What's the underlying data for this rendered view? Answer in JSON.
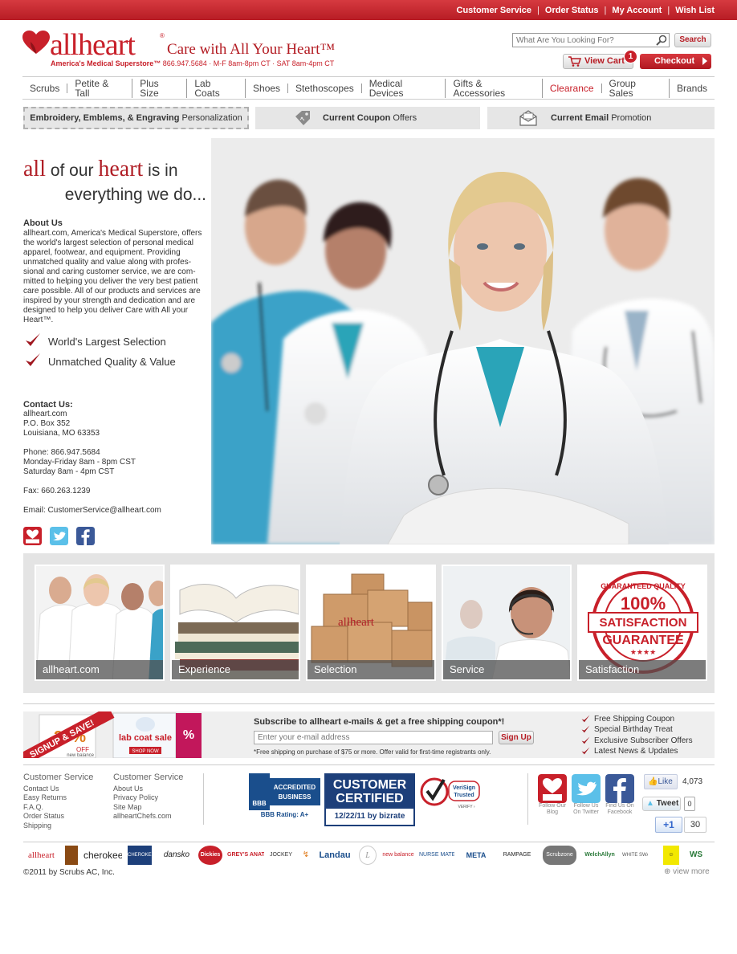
{
  "topbar": {
    "links": [
      "Customer Service",
      "Order Status",
      "My Account",
      "Wish List"
    ]
  },
  "header": {
    "logo_text": "allheart",
    "logo_tm": "®",
    "tagline": "Care with All Your Heart™",
    "subtag_name": "America's Medical Superstore™",
    "subtag_info": " 866.947.5684 · M-F 8am-8pm CT · SAT 8am-4pm CT",
    "search_placeholder": "What Are You Looking For?",
    "search_label": "Search",
    "cart_label": "View Cart",
    "cart_count": "1",
    "checkout_label": "Checkout"
  },
  "nav": [
    "Scrubs",
    "Petite & Tall",
    "Plus Size",
    "Lab Coats",
    "Shoes",
    "Stethoscopes",
    "Medical Devices",
    "Gifts & Accessories",
    "Clearance",
    "Group Sales",
    "Brands"
  ],
  "promo": {
    "p1_bold": "Embroidery, Emblems, & Engraving",
    "p1_rest": " Personalization",
    "p2_bold": "Current Coupon",
    "p2_rest": " Offers",
    "p3_bold": "Current Email",
    "p3_rest": " Promotion"
  },
  "intro": {
    "w1": "all",
    "w2": " of our ",
    "w3": "heart",
    "w4": " is in",
    "line2": "everything we do...",
    "about_title": "About Us",
    "about_text": "allheart.com, America's Medical Superstore, offers the world's largest selection of personal medical apparel, footwear, and equipment. Providing unmatched quality and value along with profes-sional and caring customer service, we are com-mitted to helping you deliver the very best patient care possible. All of our products and services are inspired by your strength and dedication and are designed to help you deliver Care with All your Heart™.",
    "check1": "World's Largest Selection",
    "check2": "Unmatched Quality & Value"
  },
  "contact": {
    "title": "Contact Us:",
    "l1": "allheart.com",
    "l2": "P.O. Box 352",
    "l3": "Louisiana, MO 63353",
    "phone": "Phone: 866.947.5684",
    "hours1": "Monday-Friday 8am - 8pm CST",
    "hours2": "Saturday 8am - 4pm CST",
    "fax": "Fax: 660.263.1239",
    "email": "Email: CustomerService@allheart.com"
  },
  "tiles": [
    "allheart.com",
    "Experience",
    "Selection",
    "Service",
    "Satisfaction"
  ],
  "tile_text": {
    "boxes": "allheart",
    "seal_1": "100%",
    "seal_2": "SATISFACTION",
    "seal_3": "GUARANTEE",
    "seal_stars": "★★★★",
    "seal_ring": "GUARANTEED QUALITY"
  },
  "signup": {
    "banner": "SIGNUP & SAVE!",
    "banner_pct": "25%",
    "banner_off": "OFF",
    "banner_brand": "new balance",
    "banner_sale": "lab coat sale",
    "banner_shop": "SHOP NOW",
    "title": "Subscribe to allheart e-mails & get a free shipping coupon*!",
    "placeholder": "Enter your e-mail address",
    "button": "Sign Up",
    "note": "*Free shipping on purchase of $75 or more. Offer valid for first-time registrants only.",
    "benefits": [
      "Free Shipping Coupon",
      "Special Birthday Treat",
      "Exclusive Subscriber Offers",
      "Latest News & Updates"
    ]
  },
  "footer": {
    "col1_title": "Customer Service",
    "col1": [
      "Contact Us",
      "Easy Returns",
      "F.A.Q.",
      "Order Status",
      "Shipping"
    ],
    "col2_title": "Customer Service",
    "col2": [
      "About Us",
      "Privacy Policy",
      "Site Map",
      "allheartChefs.com"
    ],
    "bbb_l1": "ACCREDITED",
    "bbb_l2": "BUSINESS",
    "bbb_rating": "BBB Rating: A+",
    "cc_top": "CUSTOMER CERTIFIED",
    "cc_date": "12/22/11 by bizrate",
    "verisign_l1": "VeriSign",
    "verisign_l2": "Trusted",
    "verisign_l3": "VERIFY ›",
    "follow_blog": "Follow Our Blog",
    "follow_twitter": "Follow Us On Twitter",
    "follow_fb": "Find Us On Facebook",
    "like": "Like",
    "like_count": "4,073",
    "tweet": "Tweet",
    "tweet_count": "0",
    "plus": "+1",
    "plus_count": "30",
    "copyright": "©2011 by Scrubs AC, Inc.",
    "view_more": "view more"
  },
  "brands": [
    "allheart",
    "cherokee",
    "CHEROKEE",
    "dansko",
    "Dickies",
    "GREY'S ANATOMY",
    "JOCKEY",
    "Landau",
    "new balance",
    "NURSE MATES",
    "META",
    "RAMPAGE",
    "Scrubzone",
    "WelchAllyn",
    "WHITE SWAN",
    "WS"
  ],
  "colors": {
    "brand_red": "#c8202a",
    "nav_gray": "#e6e6e6"
  }
}
